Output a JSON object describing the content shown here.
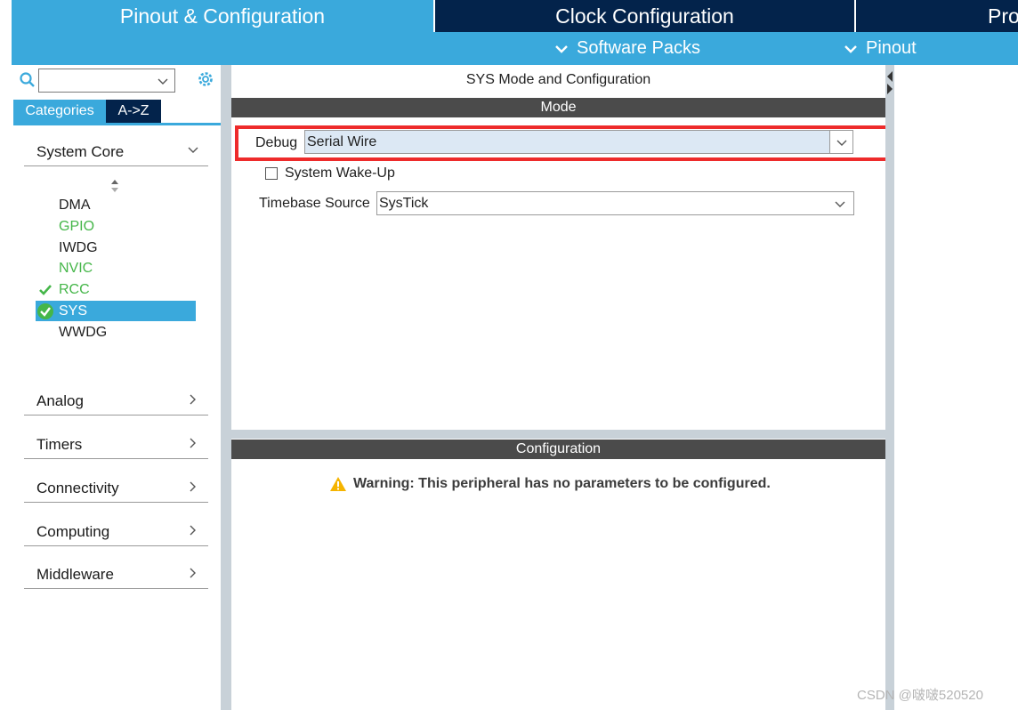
{
  "top_tabs": {
    "pinout": "Pinout & Configuration",
    "clock": "Clock Configuration",
    "project": "Project Manager"
  },
  "subbar": {
    "software_packs": "Software Packs",
    "pinout": "Pinout"
  },
  "left_panel": {
    "category_tabs": [
      "Categories",
      "A->Z"
    ],
    "groups": {
      "system_core": "System Core",
      "analog": "Analog",
      "timers": "Timers",
      "connectivity": "Connectivity",
      "computing": "Computing",
      "middleware": "Middleware"
    },
    "system_core_items": [
      "DMA",
      "GPIO",
      "IWDG",
      "NVIC",
      "RCC",
      "SYS",
      "WWDG"
    ]
  },
  "center": {
    "title": "SYS Mode and Configuration",
    "mode_header": "Mode",
    "debug_label": "Debug",
    "debug_value": "Serial Wire",
    "wakeup_label": "System Wake-Up",
    "timebase_label": "Timebase Source",
    "timebase_value": "SysTick",
    "config_header": "Configuration",
    "warning": "Warning: This peripheral has no parameters to be configured."
  },
  "watermark": "CSDN @啵啵520520",
  "colors": {
    "accent_blue": "#3aa9dc",
    "navy": "#03234b",
    "green_status": "#45b649",
    "highlight_red": "#ee2b2b"
  }
}
